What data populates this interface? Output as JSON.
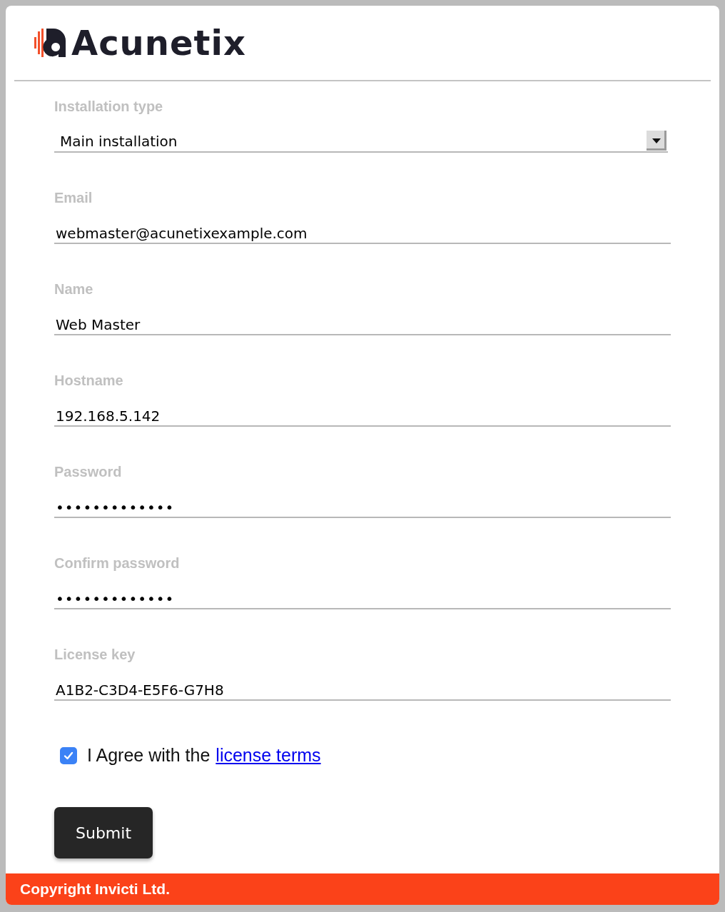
{
  "header": {
    "logo_text": "Acunetix"
  },
  "fields": [
    {
      "kind": "select",
      "label": "Installation type",
      "value": "Main installation"
    },
    {
      "kind": "text",
      "label": "Email",
      "value": "webmaster@acunetixexample.com"
    },
    {
      "kind": "text",
      "label": "Name",
      "value": "Web Master"
    },
    {
      "kind": "text",
      "label": "Hostname",
      "value": "192.168.5.142"
    },
    {
      "kind": "password",
      "label": "Password",
      "value": "•••••••••••••"
    },
    {
      "kind": "password",
      "label": "Confirm password",
      "value": "•••••••••••••"
    },
    {
      "kind": "text",
      "label": "License key",
      "value": "A1B2-C3D4-E5F6-G7H8"
    }
  ],
  "agreement": {
    "checked": true,
    "text": "I Agree with the",
    "link": "license terms"
  },
  "submit_button": "Submit",
  "footer": "Copyright Invicti Ltd."
}
